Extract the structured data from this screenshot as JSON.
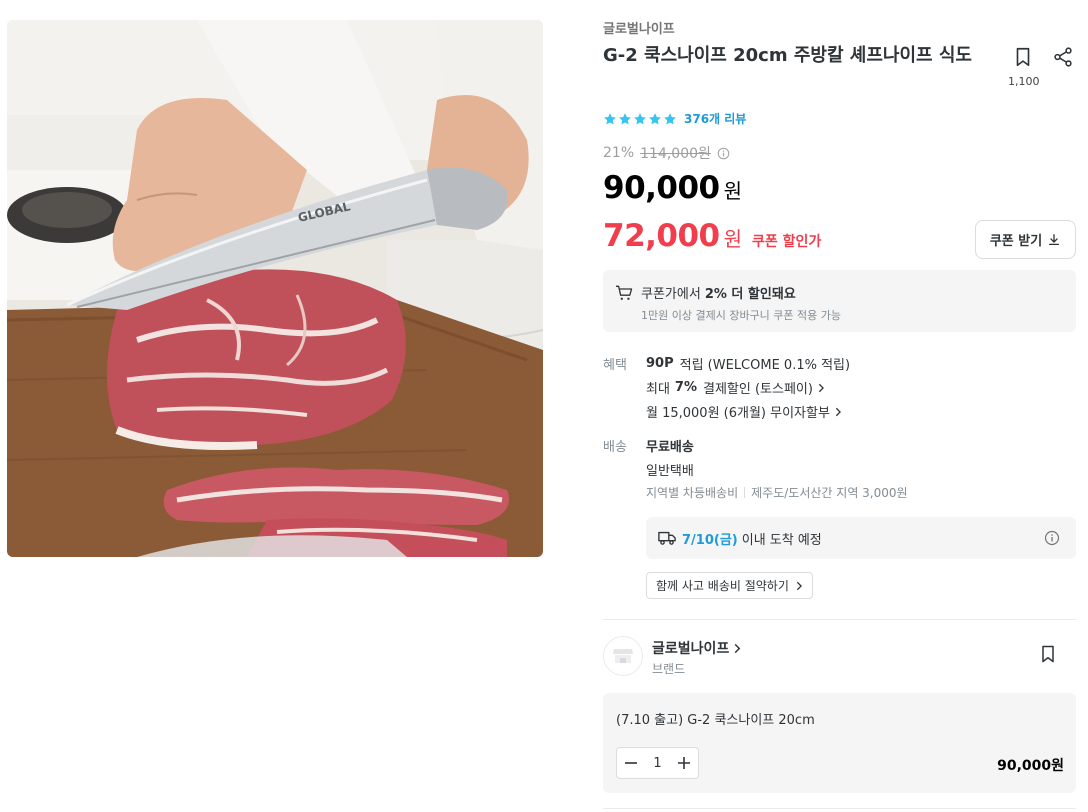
{
  "product": {
    "brand_top": "글로벌나이프",
    "title": "G-2 쿡스나이프 20cm 주방칼 셰프나이프 식도",
    "save_count": "1,100",
    "rating_stars": 5,
    "review_count": "376개 리뷰",
    "discount_rate": "21%",
    "original_price": "114,000원",
    "price": "90,000",
    "price_unit": "원",
    "coupon_price": "72,000",
    "coupon_price_unit": "원",
    "coupon_price_label": "쿠폰 할인가",
    "coupon_button_label": "쿠폰 받기"
  },
  "coupon_box": {
    "line1_prefix": "쿠폰가에서",
    "line1_bold": "2% 더 할인돼요",
    "line2": "1만원 이상 결제시 장바구니 쿠폰 적용 가능"
  },
  "benefits": {
    "label": "혜택",
    "points_bold": "90P",
    "points_text": "적립 (WELCOME 0.1% 적립)",
    "card_prefix": "최대",
    "card_bold": "7%",
    "card_text": "결제할인 (토스페이)",
    "installment": "월 15,000원 (6개월) 무이자할부"
  },
  "shipping": {
    "label": "배송",
    "free": "무료배송",
    "method": "일반택배",
    "regional": "지역별 차등배송비",
    "jeju": "제주도/도서산간 지역 3,000원",
    "arrival_date": "7/10(금)",
    "arrival_text": "이내 도착 예정",
    "bundle_button": "함께 사고 배송비 절약하기"
  },
  "brand": {
    "name": "글로벌나이프",
    "sub": "브랜드"
  },
  "option": {
    "name": "(7.10 출고) G-2 쿡스나이프 20cm",
    "quantity": "1",
    "price": "90,000원"
  },
  "colors": {
    "accent_blue": "#35c5f0",
    "coupon_red": "#f03e4d"
  }
}
